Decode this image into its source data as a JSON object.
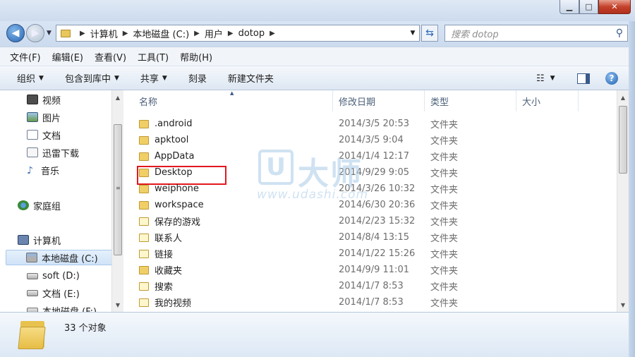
{
  "window": {
    "minimize_label": "▁",
    "maximize_label": "□",
    "close_label": "✕"
  },
  "address": {
    "crumbs": [
      "计算机",
      "本地磁盘 (C:)",
      "用户",
      "dotop"
    ],
    "search_placeholder": "搜索 dotop"
  },
  "menu": [
    "文件(F)",
    "编辑(E)",
    "查看(V)",
    "工具(T)",
    "帮助(H)"
  ],
  "toolbar": {
    "organize": "组织",
    "include_library": "包含到库中",
    "share": "共享",
    "burn": "刻录",
    "new_folder": "新建文件夹"
  },
  "sidebar": {
    "items": [
      {
        "label": "视频",
        "icon": "video-icon"
      },
      {
        "label": "图片",
        "icon": "picture-icon"
      },
      {
        "label": "文档",
        "icon": "document-icon"
      },
      {
        "label": "迅雷下载",
        "icon": "download-folder-icon"
      },
      {
        "label": "音乐",
        "icon": "music-icon"
      },
      {
        "label": "家庭组",
        "icon": "homegroup-icon"
      },
      {
        "label": "计算机",
        "icon": "computer-icon"
      },
      {
        "label": "本地磁盘 (C:)",
        "icon": "drive-icon"
      },
      {
        "label": "soft (D:)",
        "icon": "drive-icon"
      },
      {
        "label": "文档 (E:)",
        "icon": "drive-icon"
      },
      {
        "label": "本地磁盘 (F:)",
        "icon": "drive-icon"
      }
    ]
  },
  "columns": {
    "name": "名称",
    "date": "修改日期",
    "type": "类型",
    "size": "大小"
  },
  "files": [
    {
      "name": ".android",
      "date": "2014/3/5 20:53",
      "type": "文件夹"
    },
    {
      "name": "apktool",
      "date": "2014/3/5 9:04",
      "type": "文件夹"
    },
    {
      "name": "AppData",
      "date": "2014/1/4 12:17",
      "type": "文件夹"
    },
    {
      "name": "Desktop",
      "date": "2014/9/29 9:05",
      "type": "文件夹"
    },
    {
      "name": "weiphone",
      "date": "2014/3/26 10:32",
      "type": "文件夹"
    },
    {
      "name": "workspace",
      "date": "2014/6/30 20:36",
      "type": "文件夹"
    },
    {
      "name": "保存的游戏",
      "date": "2014/2/23 15:32",
      "type": "文件夹"
    },
    {
      "name": "联系人",
      "date": "2014/8/4 13:15",
      "type": "文件夹"
    },
    {
      "name": "链接",
      "date": "2014/1/22 15:26",
      "type": "文件夹"
    },
    {
      "name": "收藏夹",
      "date": "2014/9/9 11:01",
      "type": "文件夹"
    },
    {
      "name": "搜索",
      "date": "2014/1/7 8:53",
      "type": "文件夹"
    },
    {
      "name": "我的视频",
      "date": "2014/1/7 8:53",
      "type": "文件夹"
    }
  ],
  "highlight": {
    "color": "#e2181e"
  },
  "watermark": {
    "logo": "U",
    "text": "大师",
    "url": "www.udashi.com"
  },
  "status": {
    "count": "33 个对象"
  }
}
